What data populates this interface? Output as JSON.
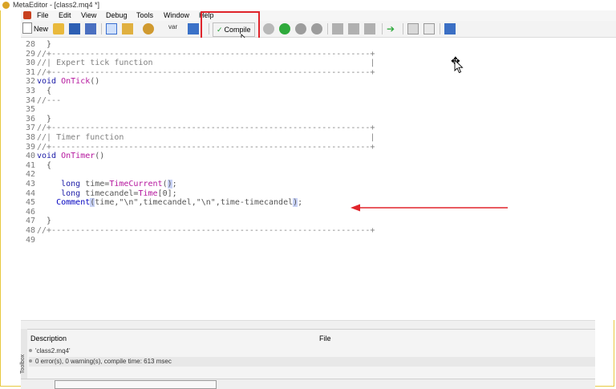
{
  "window": {
    "title": "MetaEditor - [class2.mq4 *]"
  },
  "menu": [
    "File",
    "Edit",
    "View",
    "Debug",
    "Tools",
    "Window",
    "Help"
  ],
  "toolbar": {
    "new_label": "New",
    "compile_label": "Compile",
    "compile_check": "✓"
  },
  "editor": {
    "lines": [
      {
        "n": "28",
        "t": "  }"
      },
      {
        "n": "29",
        "t": "//+------------------------------------------------------------------+"
      },
      {
        "n": "30",
        "t": "//| Expert tick function                                             |"
      },
      {
        "n": "31",
        "t": "//+------------------------------------------------------------------+"
      },
      {
        "n": "32",
        "t": "void OnTick()"
      },
      {
        "n": "33",
        "t": "  {"
      },
      {
        "n": "34",
        "t": "//---"
      },
      {
        "n": "35",
        "t": ""
      },
      {
        "n": "36",
        "t": "  }"
      },
      {
        "n": "37",
        "t": "//+------------------------------------------------------------------+"
      },
      {
        "n": "38",
        "t": "//| Timer function                                                   |"
      },
      {
        "n": "39",
        "t": "//+------------------------------------------------------------------+"
      },
      {
        "n": "40",
        "t": "void OnTimer()"
      },
      {
        "n": "41",
        "t": "  {"
      },
      {
        "n": "42",
        "t": ""
      },
      {
        "n": "43",
        "t": "     long time=TimeCurrent();"
      },
      {
        "n": "44",
        "t": "     long timecandel=Time[0];"
      },
      {
        "n": "45",
        "t": "    Comment(time,\"\\n\",timecandel,\"\\n\",time-timecandel);"
      },
      {
        "n": "46",
        "t": ""
      },
      {
        "n": "47",
        "t": "  }"
      },
      {
        "n": "48",
        "t": "//+------------------------------------------------------------------+"
      },
      {
        "n": "49",
        "t": ""
      }
    ]
  },
  "panel": {
    "close": "✕",
    "col_description": "Description",
    "col_file": "File",
    "rows": [
      "'class2.mq4'",
      "0 error(s), 0 warning(s), compile time: 613 msec"
    ],
    "side_label": "Toolbox"
  },
  "colors": {
    "highlight": "#e0242b",
    "arrow": "#e0242b",
    "keyword": "#1a1aa6",
    "function": "#b5179e"
  }
}
